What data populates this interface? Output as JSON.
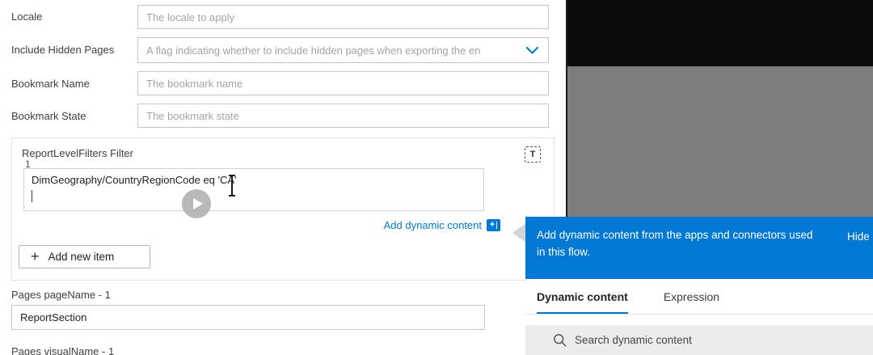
{
  "form": {
    "locale": {
      "label": "Locale",
      "placeholder": "The locale to apply"
    },
    "include_hidden_pages": {
      "label": "Include Hidden Pages",
      "placeholder": "A flag indicating whether to include hidden pages when exporting the en"
    },
    "bookmark_name": {
      "label": "Bookmark Name",
      "placeholder": "The bookmark name"
    },
    "bookmark_state": {
      "label": "Bookmark State",
      "placeholder": "The bookmark state"
    },
    "filter_section": {
      "title": "ReportLevelFilters Filter",
      "item_index": "1",
      "value_line1": "DimGeography/CountryRegionCode eq 'CA'",
      "array_toggle_glyph": "T",
      "add_dynamic_content_label": "Add dynamic content",
      "plus_glyph": "+",
      "add_new_item_label": "Add new item"
    },
    "pages_pagename": {
      "label": "Pages pageName - 1",
      "value": "ReportSection"
    },
    "pages_visualname": {
      "label": "Pages visualName - 1"
    }
  },
  "callout": {
    "banner_text": "Add dynamic content from the apps and connectors used in this flow.",
    "hide_label": "Hide",
    "tabs": [
      {
        "label": "Dynamic content",
        "active": true
      },
      {
        "label": "Expression",
        "active": false
      }
    ],
    "search_placeholder": "Search dynamic content"
  },
  "colors": {
    "accent": "#0078d4",
    "banner": "#0078d4",
    "backdrop_black": "#0b0b0b",
    "backdrop_gray": "#7d7d7d"
  }
}
